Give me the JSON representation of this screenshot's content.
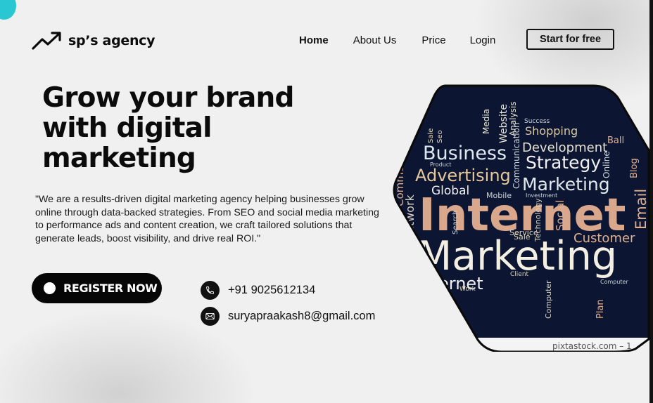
{
  "brand": {
    "name": "sp’s agency",
    "logo_icon": "trending-up-icon"
  },
  "nav": {
    "items": [
      {
        "label": "Home",
        "active": true
      },
      {
        "label": "About Us",
        "active": false
      },
      {
        "label": "Price",
        "active": false
      },
      {
        "label": "Login",
        "active": false
      }
    ],
    "cta_label": "Start for free"
  },
  "hero": {
    "headline": "Grow your brand with digital marketing",
    "description": "\"We are a results-driven digital marketing agency helping businesses grow online through data-backed strategies. From SEO and social media marketing to performance ads and content creation, we craft tailored solutions that generate leads, boost visibility, and drive real ROI.\"",
    "register_label": "REGISTER NOW",
    "phone": "+91 9025612134",
    "phone_icon": "phone-icon",
    "email": "suryapraakash8@gmail.com",
    "email_icon": "mail-icon"
  },
  "image": {
    "words": {
      "business": "Business",
      "strategy": "Strategy",
      "shopping": "Shopping",
      "development": "Development",
      "advertising": "Advertising",
      "marketing_small": "Marketing",
      "global": "Global",
      "internet_big": "Internet",
      "marketing_big": "Marketing",
      "customer": "Customer",
      "email": "Email",
      "internet_small": "ernet",
      "commerce": "Commerce",
      "network_v": "Network",
      "social": "Social",
      "website": "Website",
      "analysis": "Analysis",
      "communication": "Communication",
      "media": "Media",
      "blog": "Blog",
      "online": "Online",
      "ball": "Ball",
      "plan": "Plan",
      "computer": "Computer",
      "service": "Service",
      "sale": "Sale",
      "seo": "Seo",
      "work": "Work",
      "client": "Client",
      "technology": "Technology",
      "search": "Search",
      "mobile": "Mobile",
      "investment": "Investment",
      "product": "Product",
      "success": "Success"
    },
    "watermark": "pixtastock.com – 1"
  },
  "colors": {
    "accent_teal": "#28c7d3",
    "image_bg": "#0c1532",
    "word_cream": "#e8d9b0",
    "word_peach": "#e0b090"
  }
}
